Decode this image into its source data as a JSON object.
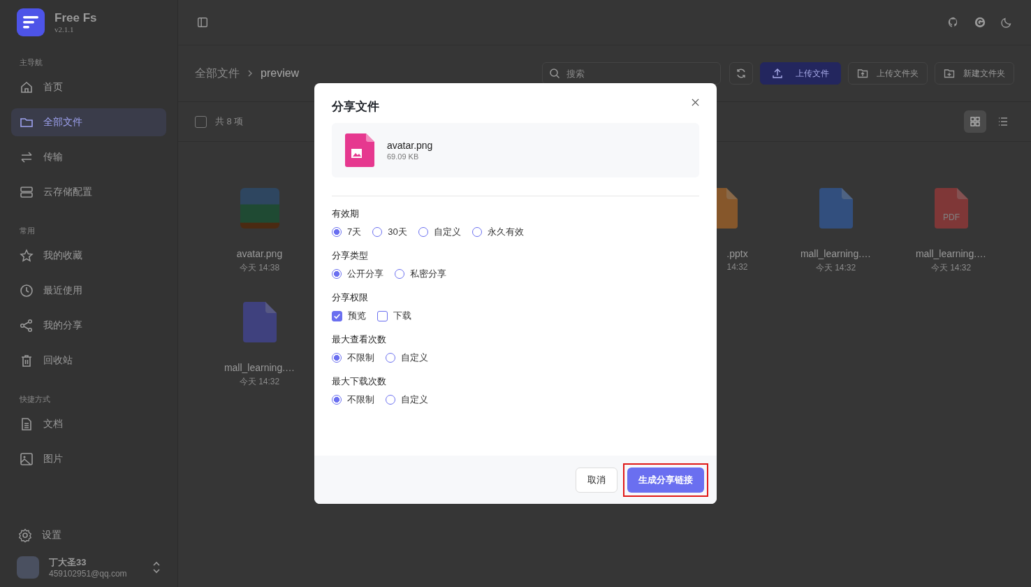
{
  "app": {
    "name": "Free Fs",
    "version": "v2.1.1"
  },
  "sidebar": {
    "sections": [
      {
        "label": "主导航",
        "items": [
          {
            "label": "首页",
            "kind": "home",
            "selected": false
          },
          {
            "label": "全部文件",
            "kind": "folder",
            "selected": true
          },
          {
            "label": "传输",
            "kind": "transfer",
            "selected": false
          },
          {
            "label": "云存储配置",
            "kind": "storage",
            "selected": false
          }
        ]
      },
      {
        "label": "常用",
        "items": [
          {
            "label": "我的收藏",
            "kind": "star",
            "selected": false
          },
          {
            "label": "最近使用",
            "kind": "clock",
            "selected": false
          },
          {
            "label": "我的分享",
            "kind": "share",
            "selected": false
          },
          {
            "label": "回收站",
            "kind": "trash",
            "selected": false
          }
        ]
      },
      {
        "label": "快捷方式",
        "items": [
          {
            "label": "文档",
            "kind": "doc",
            "selected": false
          },
          {
            "label": "图片",
            "kind": "image",
            "selected": false
          }
        ]
      }
    ],
    "settings": "设置",
    "user": {
      "name": "丁大圣33",
      "email": "459102951@qq.com"
    }
  },
  "breadcrumb": [
    "全部文件",
    "preview"
  ],
  "search": {
    "placeholder": "搜索"
  },
  "actions": [
    {
      "label": "上传文件",
      "kind": "primary"
    },
    {
      "label": "上传文件夹",
      "kind": "folder-up"
    },
    {
      "label": "新建文件夹",
      "kind": "folder-new"
    }
  ],
  "toolbar": {
    "select_all": {
      "checked": false
    },
    "count": "共 8 项",
    "views": [
      {
        "kind": "grid",
        "selected": true
      },
      {
        "kind": "list",
        "selected": false
      }
    ]
  },
  "files": [
    {
      "name": "avatar.png",
      "time": "今天 14:38",
      "kind": "image",
      "clipped": false
    },
    {
      "name": ".pptx",
      "time": "14:32",
      "kind": "pptx",
      "clipped": true
    },
    {
      "name": "mall_learning.…",
      "time": "今天 14:32",
      "kind": "word",
      "clipped": false
    },
    {
      "name": "mall_learning.…",
      "time": "今天 14:32",
      "kind": "pdf",
      "clipped": false,
      "icon_text": "PDF"
    },
    {
      "name": "mall_learning.…",
      "time": "今天 14:32",
      "kind": "text",
      "clipped": false
    }
  ],
  "dialog": {
    "title": "分享文件",
    "file": {
      "name": "avatar.png",
      "size": "69.09 KB"
    },
    "groups": [
      {
        "label": "有效期",
        "kind": "radio",
        "options": [
          {
            "label": "7天",
            "selected": true
          },
          {
            "label": "30天",
            "selected": false
          },
          {
            "label": "自定义",
            "selected": false
          },
          {
            "label": "永久有效",
            "selected": false
          }
        ]
      },
      {
        "label": "分享类型",
        "kind": "radio",
        "options": [
          {
            "label": "公开分享",
            "selected": true
          },
          {
            "label": "私密分享",
            "selected": false
          }
        ]
      },
      {
        "label": "分享权限",
        "kind": "checkbox",
        "options": [
          {
            "label": "预览",
            "checked": true
          },
          {
            "label": "下载",
            "checked": false
          }
        ]
      },
      {
        "label": "最大查看次数",
        "kind": "radio",
        "options": [
          {
            "label": "不限制",
            "selected": true
          },
          {
            "label": "自定义",
            "selected": false
          }
        ]
      },
      {
        "label": "最大下载次数",
        "kind": "radio",
        "options": [
          {
            "label": "不限制",
            "selected": true
          },
          {
            "label": "自定义",
            "selected": false
          }
        ]
      }
    ],
    "cancel": "取消",
    "confirm": "生成分享链接",
    "confirm_highlighted": true
  }
}
